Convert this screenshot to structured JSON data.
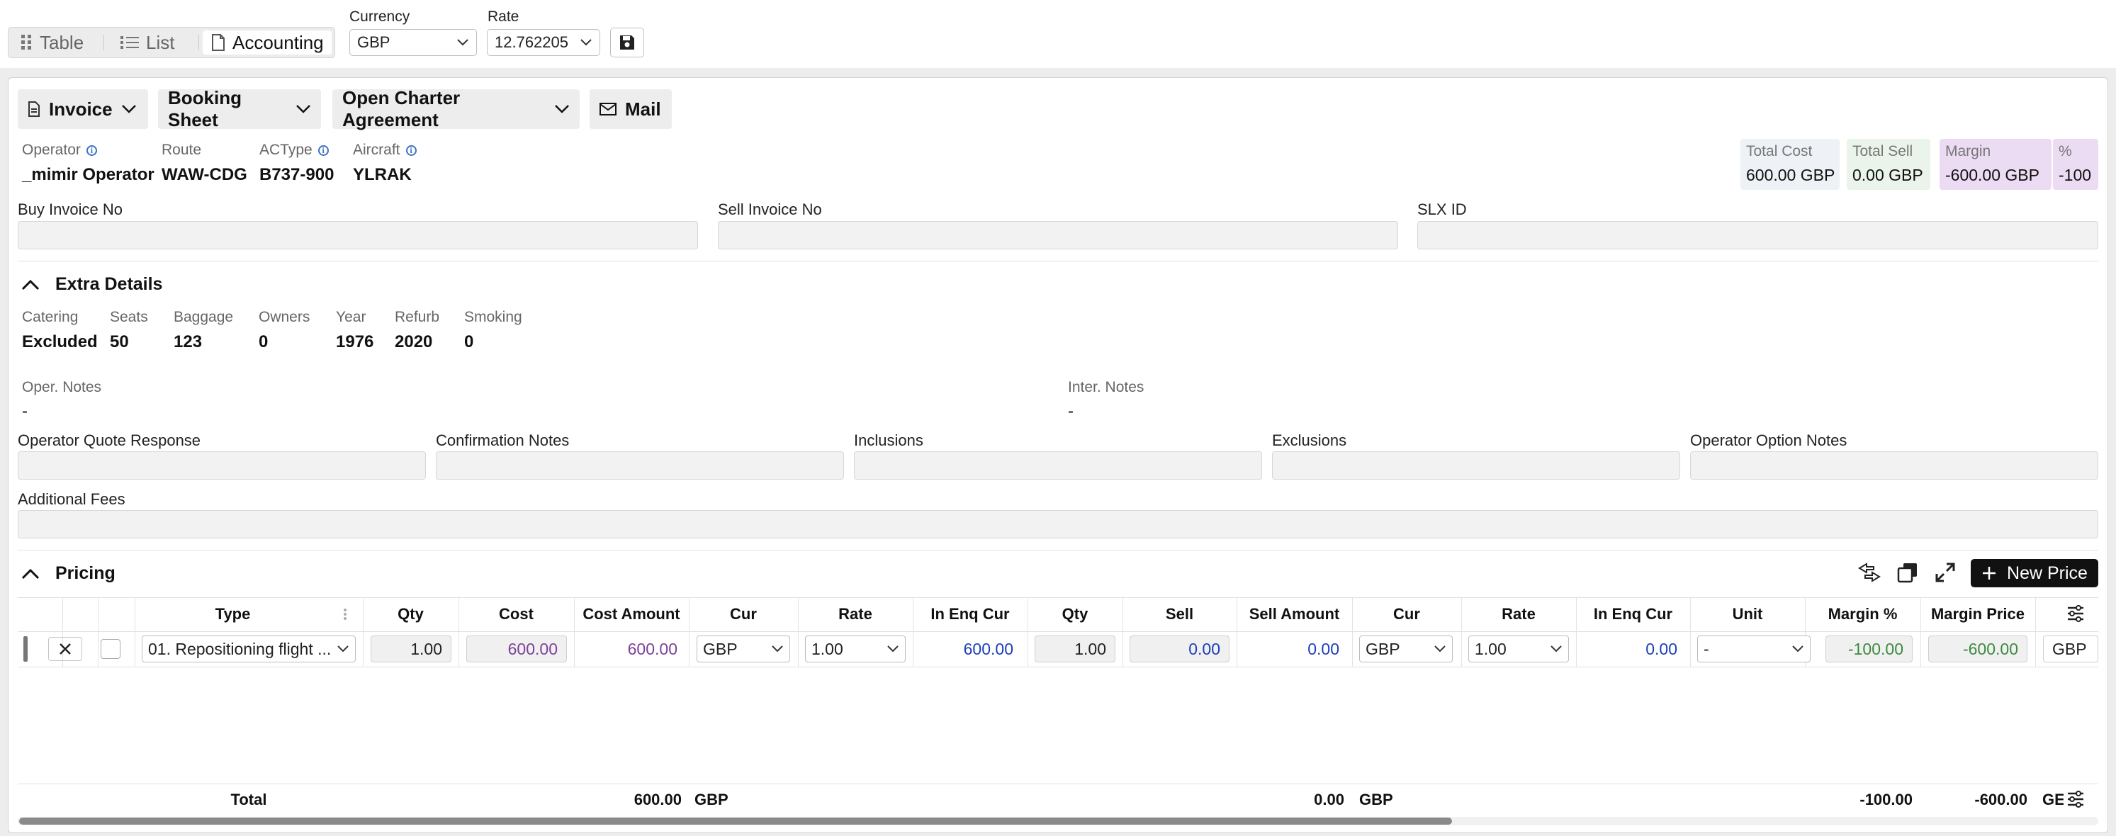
{
  "view_tabs": [
    {
      "label": "Table",
      "icon": "grid-dots-icon"
    },
    {
      "label": "List",
      "icon": "list-icon"
    },
    {
      "label": "Accounting",
      "icon": "document-icon"
    }
  ],
  "currency": {
    "label": "Currency",
    "value": "GBP"
  },
  "rate": {
    "label": "Rate",
    "value": "12.762205"
  },
  "actions": {
    "invoice": "Invoice",
    "booking_sheet": "Booking Sheet",
    "open_charter_agreement": "Open Charter Agreement",
    "mail": "Mail"
  },
  "flight": {
    "operator_label": "Operator",
    "operator": "_mimir Operator",
    "route_label": "Route",
    "route": "WAW-CDG",
    "actype_label": "ACType",
    "actype": "B737-900",
    "aircraft_label": "Aircraft",
    "aircraft": "YLRAK"
  },
  "summary": {
    "total_cost_label": "Total Cost",
    "total_cost": "600.00 GBP",
    "total_sell_label": "Total Sell",
    "total_sell": "0.00 GBP",
    "margin_label": "Margin",
    "margin": "-600.00 GBP",
    "pct_label": "%",
    "pct": "-100"
  },
  "invoice_fields": {
    "buy_label": "Buy Invoice No",
    "sell_label": "Sell Invoice No",
    "slx_label": "SLX ID"
  },
  "extra_details": {
    "title": "Extra Details",
    "items": [
      {
        "label": "Catering",
        "value": "Excluded"
      },
      {
        "label": "Seats",
        "value": "50"
      },
      {
        "label": "Baggage",
        "value": "123"
      },
      {
        "label": "Owners",
        "value": "0"
      },
      {
        "label": "Year",
        "value": "1976"
      },
      {
        "label": "Refurb",
        "value": "2020"
      },
      {
        "label": "Smoking",
        "value": "0"
      }
    ],
    "oper_notes_label": "Oper. Notes",
    "oper_notes": "-",
    "inter_notes_label": "Inter. Notes",
    "inter_notes": "-",
    "fields": [
      "Operator Quote Response",
      "Confirmation Notes",
      "Inclusions",
      "Exclusions",
      "Operator Option Notes"
    ],
    "additional_fees_label": "Additional Fees"
  },
  "pricing": {
    "title": "Pricing",
    "new_price": "New Price",
    "columns": [
      "Type",
      "Qty",
      "Cost",
      "Cost Amount",
      "Cur",
      "Rate",
      "In Enq Cur",
      "Qty",
      "Sell",
      "Sell Amount",
      "Cur",
      "Rate",
      "In Enq Cur",
      "Unit",
      "Margin %",
      "Margin Price"
    ],
    "row": {
      "type": "01. Repositioning flight ...",
      "qty": "1.00",
      "cost": "600.00",
      "cost_amount": "600.00",
      "cost_cur": "GBP",
      "cost_rate": "1.00",
      "cost_enq": "600.00",
      "sell_qty": "1.00",
      "sell": "0.00",
      "sell_amount": "0.00",
      "sell_cur": "GBP",
      "sell_rate": "1.00",
      "sell_enq": "0.00",
      "unit": "-",
      "margin_pct": "-100.00",
      "margin_price": "-600.00",
      "last_cur": "GBP"
    },
    "total": {
      "label": "Total",
      "cost_amount": "600.00",
      "cost_cur": "GBP",
      "sell_amount": "0.00",
      "sell_cur": "GBP",
      "margin_pct": "-100.00",
      "margin_price": "-600.00",
      "last_cur": "GE"
    }
  }
}
